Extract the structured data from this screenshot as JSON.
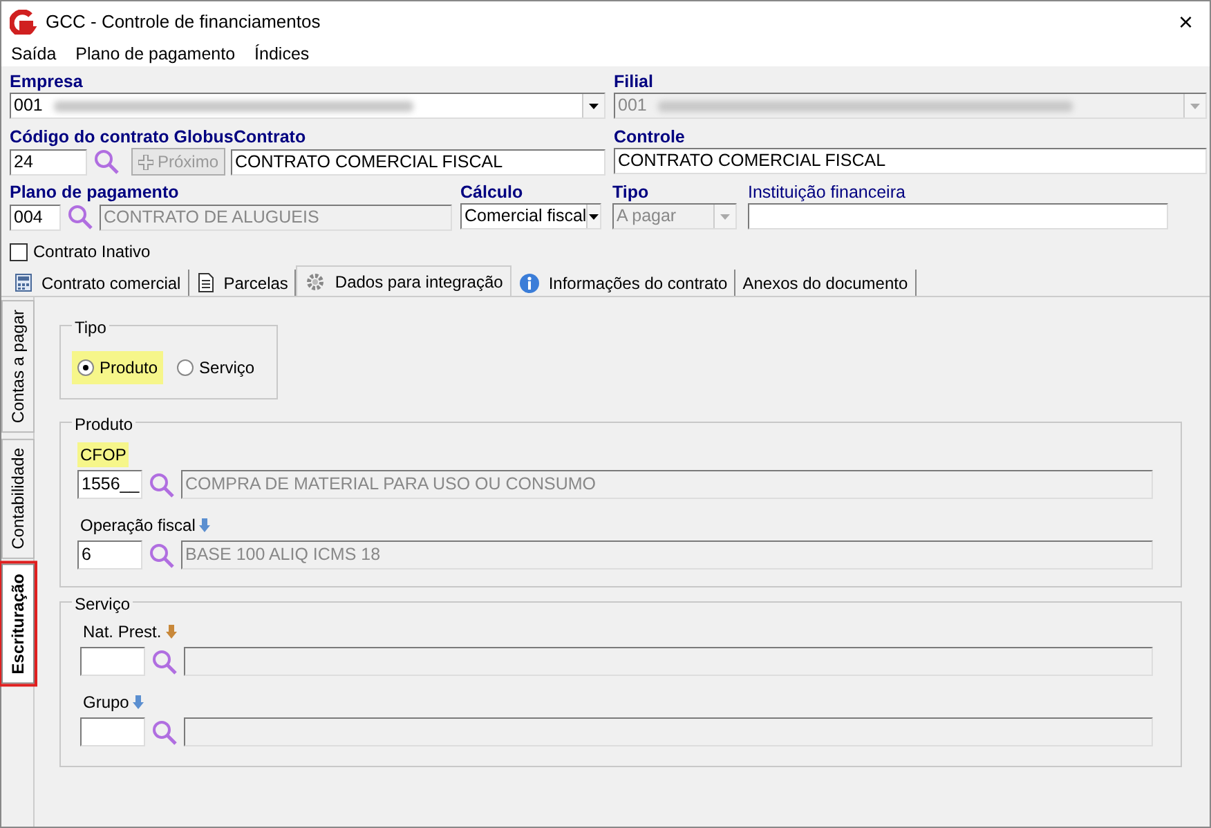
{
  "window": {
    "title": "GCC - Controle de financiamentos",
    "close": "×"
  },
  "menu": [
    {
      "label": "Saída"
    },
    {
      "label": "Plano de pagamento"
    },
    {
      "label": "Índices"
    }
  ],
  "empresa": {
    "label": "Empresa",
    "required": true,
    "value": "001",
    "disabled": false
  },
  "filial": {
    "label": "Filial",
    "required": true,
    "value": "001",
    "disabled": true
  },
  "codigo_contrato": {
    "label": "Código do contrato Globus",
    "required": true,
    "value": "24"
  },
  "proximo_button": {
    "label": "Próximo",
    "disabled": true
  },
  "contrato": {
    "label": "Contrato",
    "required": true,
    "value": "CONTRATO COMERCIAL FISCAL"
  },
  "controle": {
    "label": "Controle",
    "required": true,
    "value": "CONTRATO COMERCIAL FISCAL"
  },
  "plano_pagamento": {
    "label": "Plano de pagamento",
    "required": true,
    "code": "004",
    "description": "CONTRATO DE ALUGUEIS"
  },
  "calculo": {
    "label": "Cálculo",
    "required": true,
    "value": "Comercial fiscal",
    "disabled": false
  },
  "tipo": {
    "label": "Tipo",
    "required": true,
    "value": "A pagar",
    "disabled": true
  },
  "instituicao": {
    "label": "Instituição financeira",
    "required": false
  },
  "contrato_inativo": {
    "label": "Contrato Inativo",
    "checked": false
  },
  "tabs": [
    {
      "label": "Contrato comercial",
      "selected": false
    },
    {
      "label": "Parcelas",
      "selected": false
    },
    {
      "label": "Dados para integração",
      "selected": true
    },
    {
      "label": "Informações do contrato",
      "selected": false
    },
    {
      "label": "Anexos do documento",
      "selected": false
    }
  ],
  "side_tabs": [
    {
      "label": "Contas a pagar",
      "selected": false,
      "highlighted": false
    },
    {
      "label": "Contabilidade",
      "selected": false,
      "highlighted": false
    },
    {
      "label": "Escrituração",
      "selected": true,
      "highlighted": true
    }
  ],
  "tipo_group": {
    "title": "Tipo",
    "options": [
      {
        "label": "Produto",
        "selected": true,
        "highlighted": true
      },
      {
        "label": "Serviço",
        "selected": false,
        "highlighted": false
      }
    ]
  },
  "produto_group": {
    "title": "Produto",
    "fields": [
      {
        "label": "CFOP",
        "code": "1556__",
        "description": "COMPRA DE MATERIAL PARA USO OU CONSUMO",
        "highlighted": true
      },
      {
        "label": "Operação fiscal",
        "code": "6",
        "description": "BASE 100 ALIQ ICMS 18",
        "highlighted": false,
        "indicator": {
          "color": "#5b8fd0"
        }
      }
    ]
  },
  "servico_group": {
    "title": "Serviço",
    "fields": [
      {
        "label": "Nat. Prest.",
        "highlighted": false,
        "indicator": {
          "color": "#c8883a"
        }
      },
      {
        "label": "Grupo",
        "highlighted": false,
        "indicator": {
          "color": "#5b8fd0"
        }
      }
    ]
  }
}
